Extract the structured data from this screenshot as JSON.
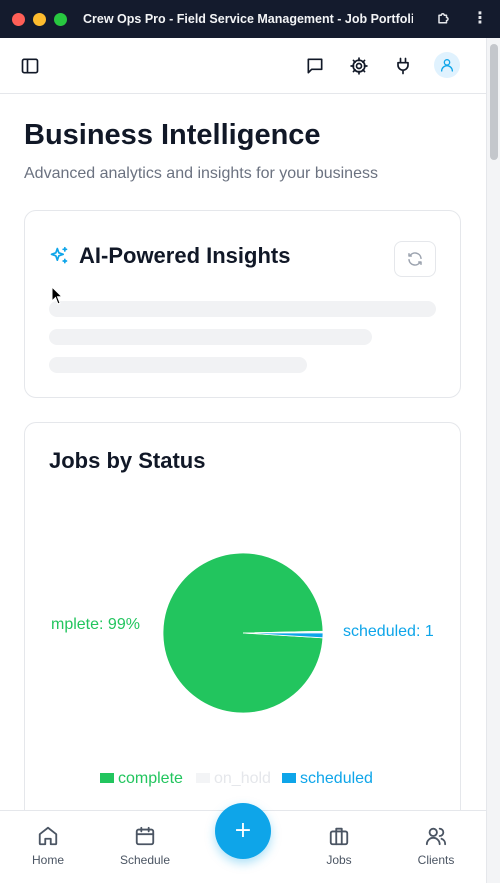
{
  "window": {
    "title": "Crew Ops Pro - Field Service Management - Job Portfolio..."
  },
  "header": {
    "sidebar_icon": "sidebar-toggle-icon",
    "messages_icon": "message-icon",
    "settings_icon": "gear-icon",
    "integrations_icon": "plug-icon",
    "profile_icon": "user-icon"
  },
  "page": {
    "title": "Business Intelligence",
    "subtitle": "Advanced analytics and insights for your business"
  },
  "ai_insights": {
    "title": "AI-Powered Insights",
    "icon": "sparkles-icon",
    "refresh_icon": "refresh-icon",
    "loading": true
  },
  "jobs_by_status": {
    "title": "Jobs by Status"
  },
  "chart_data": {
    "type": "pie",
    "title": "Jobs by Status",
    "categories": [
      "complete",
      "on_hold",
      "scheduled"
    ],
    "values": [
      99,
      0.3,
      1
    ],
    "slice_labels": [
      "mplete: 99%",
      "",
      "scheduled: 1"
    ],
    "colors": [
      "#22c55e",
      "#f3f4f6",
      "#0ea5e9"
    ],
    "legend": {
      "placement": "bottom",
      "entries": [
        "complete",
        "on_hold",
        "scheduled"
      ]
    }
  },
  "bottom_nav": {
    "items": [
      {
        "label": "Home",
        "icon": "home-icon"
      },
      {
        "label": "Schedule",
        "icon": "calendar-icon"
      },
      {
        "label": "Jobs",
        "icon": "briefcase-icon"
      },
      {
        "label": "Clients",
        "icon": "users-icon"
      }
    ],
    "fab_icon": "plus-icon",
    "fab_symbol": "+"
  },
  "colors": {
    "accent": "#0ea5e9",
    "success": "#22c55e",
    "text": "#111827",
    "muted": "#6b7280"
  }
}
